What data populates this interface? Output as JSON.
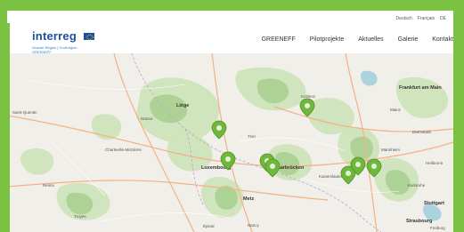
{
  "colors": {
    "frame_green": "#7cc242",
    "logo_blue": "#1c4f9c",
    "marker_green": "#6fb83a"
  },
  "logo": {
    "name": "interreg",
    "line1": "Grande Région | Großregion",
    "line2": "GREENEFF"
  },
  "lang_bar": [
    "Deutsch",
    "Français",
    "DE"
  ],
  "nav": [
    "GREENEFF",
    "Pilotprojekte",
    "Aktuelles",
    "Galerie",
    "Kontakt"
  ],
  "map": {
    "places": [
      "Saint-Quentin",
      "Frankfurt am Main",
      "Mainz",
      "Metz",
      "Nancy",
      "Saarbrücken",
      "Trier",
      "Luxembourg",
      "Reims",
      "Troyes",
      "Strasbourg",
      "Karlsruhe",
      "Mannheim",
      "Darmstadt",
      "Heilbronn",
      "Stuttgart",
      "Liège",
      "Namur",
      "Charleville-Mézières",
      "Koblenz",
      "Kaiserslautern",
      "Épinal",
      "Freiburg"
    ],
    "marker_count": 8
  }
}
